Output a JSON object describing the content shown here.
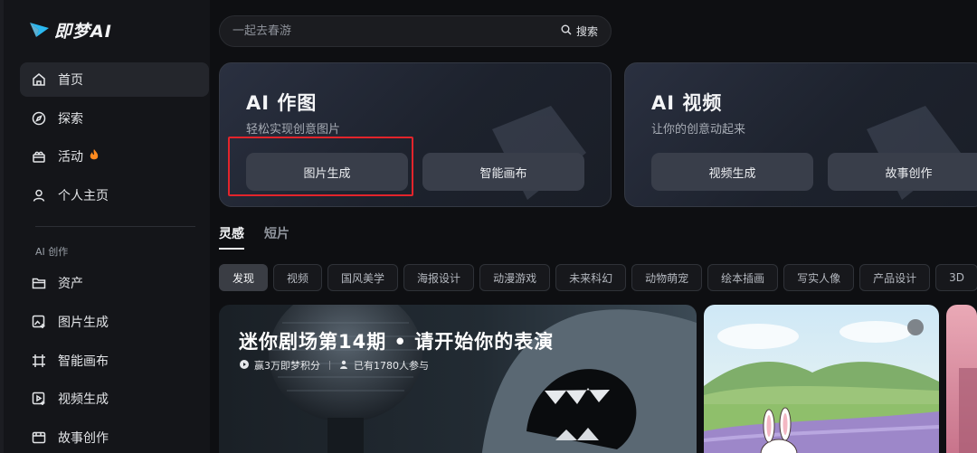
{
  "app": {
    "logo_text": "即梦AI"
  },
  "sidebar": {
    "items": [
      {
        "label": "首页",
        "icon": "home-icon",
        "active": true
      },
      {
        "label": "探索",
        "icon": "compass-icon"
      },
      {
        "label": "活动",
        "icon": "gift-icon",
        "badge_icon": "fire-icon"
      },
      {
        "label": "个人主页",
        "icon": "user-icon"
      }
    ],
    "section_label": "AI 创作",
    "create_items": [
      {
        "label": "资产",
        "icon": "folder-icon"
      },
      {
        "label": "图片生成",
        "icon": "image-gen-icon"
      },
      {
        "label": "智能画布",
        "icon": "canvas-icon"
      },
      {
        "label": "视频生成",
        "icon": "video-gen-icon"
      },
      {
        "label": "故事创作",
        "icon": "story-icon"
      }
    ]
  },
  "search": {
    "placeholder": "一起去春游",
    "button_label": "搜索"
  },
  "cards": [
    {
      "title": "AI 作图",
      "subtitle": "轻松实现创意图片",
      "buttons": [
        "图片生成",
        "智能画布"
      ]
    },
    {
      "title": "AI 视频",
      "subtitle": "让你的创意动起来",
      "buttons": [
        "视频生成",
        "故事创作"
      ]
    }
  ],
  "tabs": [
    {
      "label": "灵感",
      "active": true
    },
    {
      "label": "短片"
    }
  ],
  "chips": [
    "发现",
    "视频",
    "国风美学",
    "海报设计",
    "动漫游戏",
    "未来科幻",
    "动物萌宠",
    "绘本插画",
    "写实人像",
    "产品设计",
    "3D"
  ],
  "banner": {
    "title": "迷你剧场第14期 • 请开始你的表演",
    "reward": "赢3万即梦积分",
    "participants": "已有1780人参与"
  },
  "colors": {
    "highlight": "#e3242b",
    "logo_accent": "#2bb8f0"
  }
}
